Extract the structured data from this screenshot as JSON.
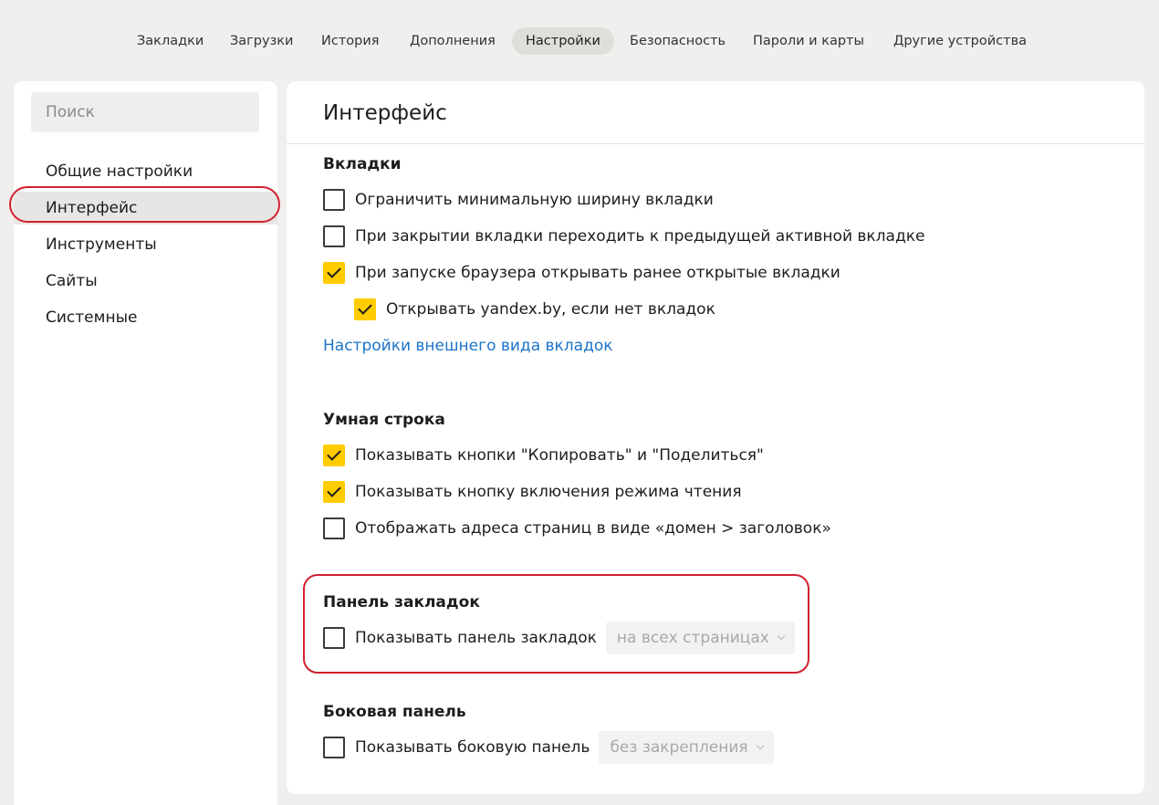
{
  "topnav": {
    "tabs": [
      {
        "label": "Закладки"
      },
      {
        "label": "Загрузки"
      },
      {
        "label": "История"
      },
      {
        "label": "Дополнения"
      },
      {
        "label": "Настройки",
        "active": true
      },
      {
        "label": "Безопасность"
      },
      {
        "label": "Пароли и карты"
      },
      {
        "label": "Другие устройства"
      }
    ]
  },
  "sidebar": {
    "search_placeholder": "Поиск",
    "items": [
      {
        "label": "Общие настройки"
      },
      {
        "label": "Интерфейс",
        "active": true
      },
      {
        "label": "Инструменты"
      },
      {
        "label": "Сайты"
      },
      {
        "label": "Системные"
      }
    ]
  },
  "main": {
    "title": "Интерфейс",
    "tabs_section": {
      "title": "Вкладки",
      "options": [
        {
          "label": "Ограничить минимальную ширину вкладки",
          "checked": false
        },
        {
          "label": "При закрытии вкладки переходить к предыдущей активной вкладке",
          "checked": false
        },
        {
          "label": "При запуске браузера открывать ранее открытые вкладки",
          "checked": true
        },
        {
          "label": "Открывать yandex.by, если нет вкладок",
          "checked": true
        }
      ],
      "link": "Настройки внешнего вида вкладок"
    },
    "smartbar_section": {
      "title": "Умная строка",
      "options": [
        {
          "label": "Показывать кнопки \"Копировать\" и \"Поделиться\"",
          "checked": true
        },
        {
          "label": "Показывать кнопку включения режима чтения",
          "checked": true
        },
        {
          "label": "Отображать адреса страниц в виде «домен > заголовок»",
          "checked": false
        }
      ]
    },
    "bookmarks_section": {
      "title": "Панель закладок",
      "option": {
        "label": "Показывать панель закладок",
        "checked": false
      },
      "select_value": "на всех страницах"
    },
    "sidepanel_section": {
      "title": "Боковая панель",
      "option": {
        "label": "Показывать боковую панель",
        "checked": false
      },
      "select_value": "без закрепления"
    }
  },
  "colors": {
    "background": "#f1efed",
    "panel": "#ffffff",
    "checkbox_checked": "#ffcc00",
    "link": "#1b74c9",
    "annotation": "#d0202e"
  }
}
